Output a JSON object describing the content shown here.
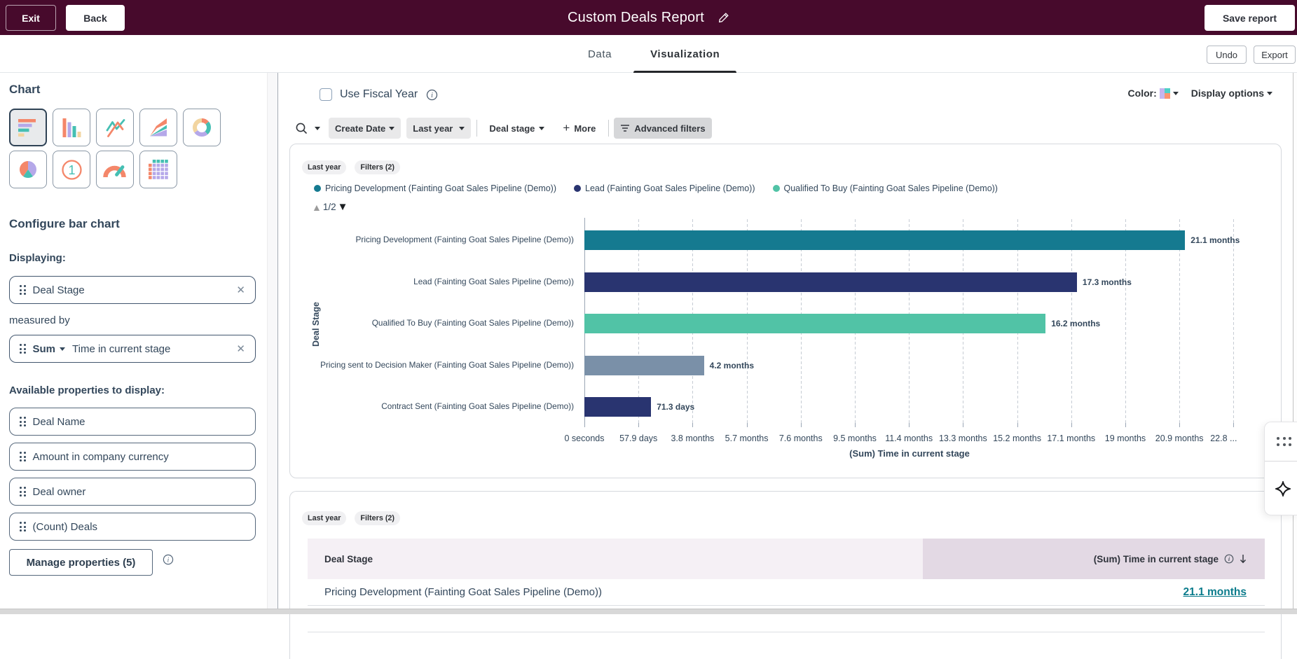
{
  "topbar": {
    "exit": "Exit",
    "back": "Back",
    "title": "Custom Deals Report",
    "save": "Save report"
  },
  "tabs": {
    "data": "Data",
    "visualization": "Visualization",
    "undo": "Undo",
    "export": "Export"
  },
  "sidebar": {
    "chart_heading": "Chart",
    "chart_types": [
      "Horizontal bar",
      "Column",
      "Line",
      "Area",
      "Donut",
      "Pie",
      "Single value",
      "Gauge",
      "Table"
    ],
    "selected_chart_type": "Horizontal bar",
    "configure_heading": "Configure bar chart",
    "displaying_label": "Displaying:",
    "displaying_field": "Deal Stage",
    "measured_by_label": "measured by",
    "measure_aggregation": "Sum",
    "measure_field": "Time in current stage",
    "available_heading": "Available properties to display:",
    "properties": [
      "Deal Name",
      "Amount in company currency",
      "Deal owner",
      "(Count) Deals"
    ],
    "manage_button": "Manage properties (5)"
  },
  "toolbar": {
    "fiscal_label": "Use Fiscal Year",
    "color_label": "Color:",
    "color_swatch": [
      "#c5b3ee",
      "#4fd0c6",
      "#c5b6ef",
      "#f99471"
    ],
    "display_options": "Display options",
    "search_filter": "Search",
    "create_date": "Create Date",
    "date_range": "Last year",
    "deal_stage": "Deal stage",
    "more": "More",
    "advanced_filters": "Advanced filters"
  },
  "chart_card": {
    "tags": [
      "Last year",
      "Filters (2)"
    ],
    "pagination": "1/2"
  },
  "chart_data": {
    "type": "bar",
    "orientation": "horizontal",
    "title": "",
    "xlabel": "(Sum) Time in current stage",
    "ylabel": "Deal Stage",
    "categories": [
      "Pricing Development (Fainting Goat Sales Pipeline (Demo))",
      "Lead (Fainting Goat Sales Pipeline (Demo))",
      "Qualified To Buy (Fainting Goat Sales Pipeline (Demo))",
      "Pricing sent to Decision Maker (Fainting Goat Sales Pipeline (Demo))",
      "Contract Sent (Fainting Goat Sales Pipeline (Demo))"
    ],
    "values_months": [
      21.1,
      17.3,
      16.2,
      4.2,
      2.343
    ],
    "value_labels": [
      "21.1 months",
      "17.3 months",
      "16.2 months",
      "4.2 months",
      "71.3 days"
    ],
    "bar_colors": [
      "#157a90",
      "#293470",
      "#51c3a6",
      "#7a90a8",
      "#293470"
    ],
    "x_ticks": [
      "0 seconds",
      "57.9 days",
      "3.8 months",
      "5.7 months",
      "7.6 months",
      "9.5 months",
      "11.4 months",
      "13.3 months",
      "15.2 months",
      "17.1 months",
      "19 months",
      "20.9 months",
      "22.8 ..."
    ],
    "x_tick_step_months": 1.9,
    "xlim_months": [
      0,
      24.7
    ],
    "grid": "vertical-dashed",
    "legend_position": "top",
    "legend": [
      {
        "label": "Pricing Development (Fainting Goat Sales Pipeline (Demo))",
        "color": "#157a90"
      },
      {
        "label": "Lead (Fainting Goat Sales Pipeline (Demo))",
        "color": "#293470"
      },
      {
        "label": "Qualified To Buy (Fainting Goat Sales Pipeline (Demo))",
        "color": "#51c3a6"
      }
    ]
  },
  "table_card": {
    "tags": [
      "Last year",
      "Filters (2)"
    ],
    "col1": "Deal Stage",
    "col2": "(Sum) Time in current stage",
    "sort_direction": "desc",
    "rows": [
      {
        "stage": "Pricing Development (Fainting Goat Sales Pipeline (Demo))",
        "value": "21.1 months"
      },
      {
        "stage": "",
        "value": ""
      }
    ]
  }
}
